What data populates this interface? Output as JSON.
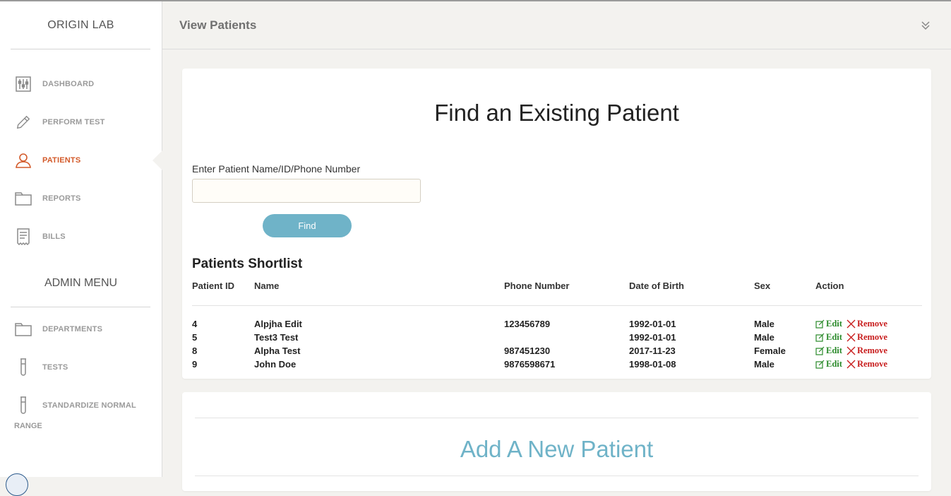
{
  "app": {
    "brand": "ORIGIN LAB"
  },
  "sidebar": {
    "items": [
      {
        "label": "DASHBOARD",
        "icon": "sliders-icon"
      },
      {
        "label": "PERFORM TEST",
        "icon": "pencil-icon"
      },
      {
        "label": "PATIENTS",
        "icon": "user-icon",
        "active": true
      },
      {
        "label": "REPORTS",
        "icon": "folder-icon"
      },
      {
        "label": "BILLS",
        "icon": "receipt-icon"
      }
    ],
    "admin_title": "ADMIN MENU",
    "admin_items": [
      {
        "label": "DEPARTMENTS",
        "icon": "folder-icon"
      },
      {
        "label": "TESTS",
        "icon": "test-tube-icon"
      },
      {
        "label": "STANDARDIZE NORMAL",
        "label_cont": "RANGE",
        "icon": "test-tube-icon"
      }
    ]
  },
  "header": {
    "title": "View Patients"
  },
  "find": {
    "title": "Find an Existing Patient",
    "search_label": "Enter Patient Name/ID/Phone Number",
    "search_value": "",
    "search_placeholder": "",
    "button_label": "Find"
  },
  "shortlist": {
    "title": "Patients Shortlist",
    "columns": [
      "Patient ID",
      "Name",
      "Phone Number",
      "Date of Birth",
      "Sex",
      "Action"
    ],
    "rows": [
      {
        "id": "4",
        "name": "Alpjha Edit",
        "phone": "123456789",
        "dob": "1992-01-01",
        "sex": "Male"
      },
      {
        "id": "5",
        "name": "Test3 Test",
        "phone": "",
        "dob": "1992-01-01",
        "sex": "Male"
      },
      {
        "id": "8",
        "name": "Alpha Test",
        "phone": "987451230",
        "dob": "2017-11-23",
        "sex": "Female"
      },
      {
        "id": "9",
        "name": "John Doe",
        "phone": "9876598671",
        "dob": "1998-01-08",
        "sex": "Male"
      }
    ],
    "edit_label": "Edit",
    "remove_label": "Remove"
  },
  "add": {
    "title": "Add A New Patient"
  },
  "colors": {
    "accent": "#6fb3c8",
    "active_nav": "#d35a2a",
    "edit": "#2a8a2a",
    "remove": "#c81e1e"
  }
}
